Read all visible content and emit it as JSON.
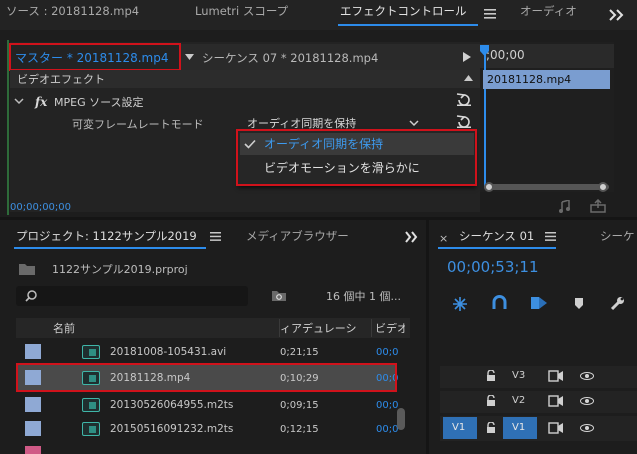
{
  "top_tabs": {
    "source": "ソース : 20181128.mp4",
    "lumetri": "Lumetri スコープ",
    "effect_controls": "エフェクトコントロール",
    "audio": "オーディオ"
  },
  "effect_controls": {
    "master_clip": "マスター * 20181128.mp4",
    "sequence_clip": "シーケンス 07 * 20181128.mp4",
    "section_label": "ビデオエフェクト",
    "effect_name": "MPEG ソース設定",
    "param_label": "可変フレームレートモード",
    "param_value": "オーディオ同期を保持",
    "dropdown_options": [
      "オーディオ同期を保持",
      "ビデオモーションを滑らかに"
    ],
    "selected_option_index": 0,
    "timecode": "00;00;00;00",
    "timeline_time": ";00;00",
    "timeline_clip": "20181128.mp4"
  },
  "project": {
    "tab_label": "プロジェクト: 1122サンプル2019",
    "tab_media_browser": "メディアブラウザー",
    "file_name": "1122サンプル2019.prproj",
    "item_count": "16 個中 1 個...",
    "columns": {
      "name": "名前",
      "duration": "ィアデュレーシ",
      "video": "ビデオ"
    },
    "rows": [
      {
        "name": "20181008-105431.avi",
        "duration": "0;21;15",
        "video": "00;0",
        "selected": false
      },
      {
        "name": "20181128.mp4",
        "duration": "0;10;29",
        "video": "00;0",
        "selected": true
      },
      {
        "name": "20130526064955.m2ts",
        "duration": "0;09;15",
        "video": "00;0",
        "selected": false
      },
      {
        "name": "20150516091232.m2ts",
        "duration": "0;12;15",
        "video": "00;0",
        "selected": false
      }
    ]
  },
  "sequence": {
    "close_glyph": "×",
    "tab_label": "シーケンス 01",
    "tab_other": "シーケ",
    "timecode": "00;00;53;11",
    "tracks": [
      {
        "label": "V3",
        "source": ""
      },
      {
        "label": "V2",
        "source": ""
      },
      {
        "label": "V1",
        "source": "V1"
      }
    ]
  },
  "colors": {
    "accent": "#2d8ceb",
    "highlight": "#d0121b",
    "panel": "#1d1d1d",
    "header": "#2a2a2a"
  }
}
